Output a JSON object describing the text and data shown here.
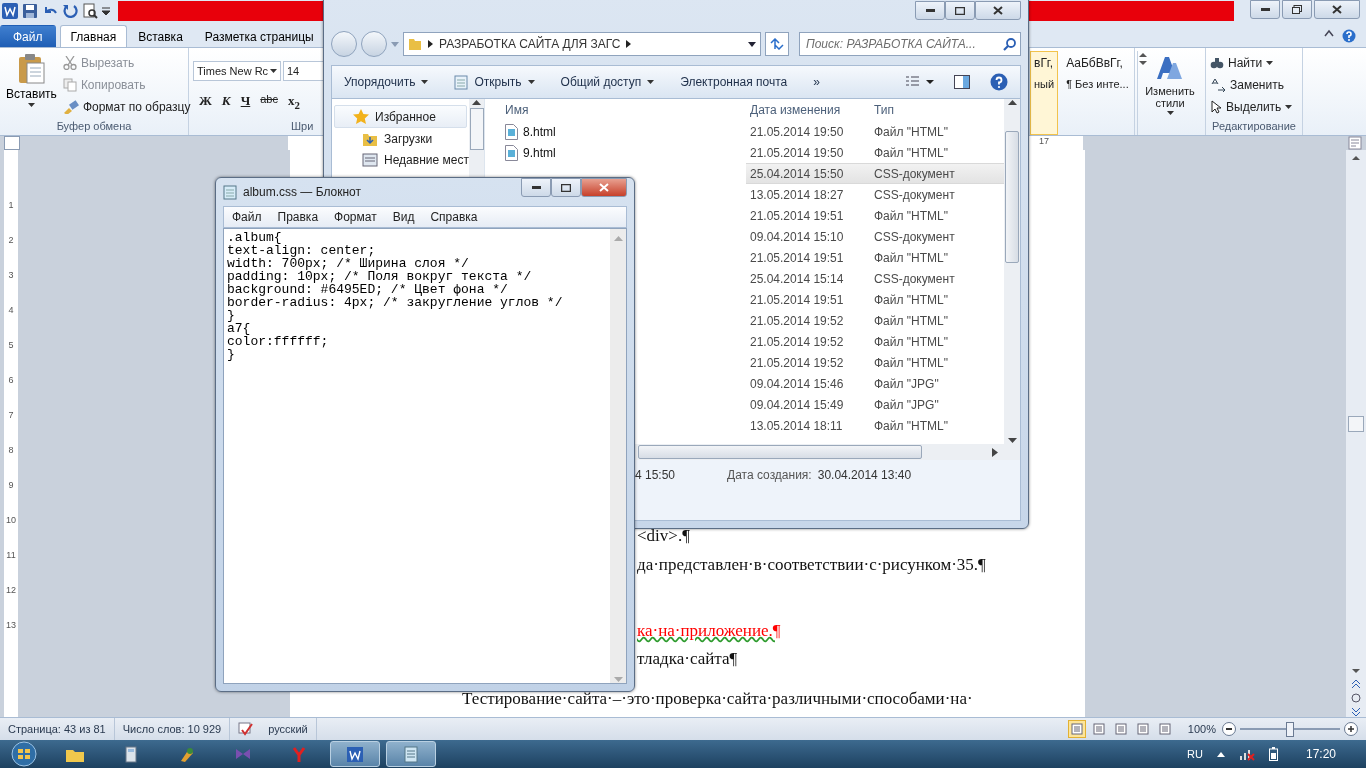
{
  "word": {
    "tabs": [
      {
        "label": "Файл",
        "kind": "file",
        "selected": false
      },
      {
        "label": "Главная",
        "kind": "tab",
        "selected": true
      },
      {
        "label": "Вставка",
        "kind": "tab",
        "selected": false
      },
      {
        "label": "Разметка страницы",
        "kind": "tab",
        "selected": false
      }
    ],
    "clipboard": {
      "paste": "Вставить",
      "cut": "Вырезать",
      "copy": "Копировать",
      "format_painter": "Формат по образцу",
      "group_label": "Буфер обмена"
    },
    "font": {
      "name": "Times New Rc",
      "size": "14",
      "format_buttons": [
        "Ж",
        "К",
        "Ч",
        "abc",
        "x$_{2}$"
      ],
      "group_label": "Шри"
    },
    "styles": [
      {
        "sample": "вГг,",
        "caption": "ный",
        "selected": true
      },
      {
        "sample": "АаБбВвГг,",
        "caption": "¶ Без инте...",
        "selected": false
      }
    ],
    "change_styles": "Изменить стили",
    "editing": {
      "find": "Найти",
      "replace": "Заменить",
      "select": "Выделить",
      "group_label": "Редактирование"
    },
    "ruler_label": "17",
    "vertical_ruler": [
      "1",
      "2",
      "3",
      "4",
      "5",
      "6",
      "7",
      "8",
      "9",
      "10",
      "11",
      "12",
      "13"
    ],
    "paragraphs": [
      {
        "text": "<div>.¶",
        "kind": "partial"
      },
      {
        "text": "да·представлен·в·соответствии·с·рисунком·35.¶",
        "kind": "partial"
      },
      {
        "text": "ка·на·приложение.¶",
        "kind": "gap",
        "color": "#ff0000"
      },
      {
        "text": "тладка·сайта¶",
        "kind": "partial"
      },
      {
        "text": "Тестирование·сайта·–·это·проверка·сайта·различными·способами·на·",
        "kind": "body"
      }
    ],
    "status_bar": {
      "page": "Страница: 43 из 81",
      "words": "Число слов: 10 929",
      "language": "русский",
      "views": [
        {
          "selected": true
        },
        {
          "selected": false
        },
        {
          "selected": false
        },
        {
          "selected": false
        },
        {
          "selected": false
        }
      ],
      "zoom": "100%",
      "zoom_slider": {
        "level": 0.5
      }
    }
  },
  "explorer": {
    "path": "РАЗРАБОТКА САЙТА ДЛЯ ЗАГС",
    "search": {
      "placeholder": "Поиск: РАЗРАБОТКА САЙТА..."
    },
    "toolbar": [
      {
        "label": "Упорядочить",
        "kind": "menu"
      },
      {
        "label": "Открыть",
        "kind": "open"
      },
      {
        "label": "Общий доступ",
        "kind": "menu"
      },
      {
        "label": "Электронная почта",
        "kind": "plain"
      },
      {
        "label": "»",
        "kind": "plain"
      }
    ],
    "nav": [
      {
        "label": "Избранное",
        "kind": "group"
      },
      {
        "label": "Загрузки",
        "kind": "downloads"
      },
      {
        "label": "Недавние мест",
        "kind": "recent"
      }
    ],
    "columns": [
      "Имя",
      "Дата изменения",
      "Тип"
    ],
    "rows": [
      {
        "name": "8.html",
        "date": "21.05.2014 19:50",
        "type": "Файл \"HTML\"",
        "selected": false
      },
      {
        "name": "9.html",
        "date": "21.05.2014 19:50",
        "type": "Файл \"HTML\"",
        "selected": false
      },
      {
        "date": "25.04.2014 15:50",
        "type": "CSS-документ",
        "selected": true
      },
      {
        "date": "13.05.2014 18:27",
        "type": "CSS-документ",
        "selected": false
      },
      {
        "date": "21.05.2014 19:51",
        "type": "Файл \"HTML\"",
        "selected": false
      },
      {
        "date": "09.04.2014 15:10",
        "type": "CSS-документ",
        "selected": false
      },
      {
        "date": "21.05.2014 19:51",
        "type": "Файл \"HTML\"",
        "selected": false
      },
      {
        "date": "25.04.2014 15:14",
        "type": "CSS-документ",
        "selected": false
      },
      {
        "date": "21.05.2014 19:51",
        "type": "Файл \"HTML\"",
        "selected": false
      },
      {
        "date": "21.05.2014 19:52",
        "type": "Файл \"HTML\"",
        "selected": false
      },
      {
        "date": "21.05.2014 19:52",
        "type": "Файл \"HTML\"",
        "selected": false
      },
      {
        "date": "21.05.2014 19:52",
        "type": "Файл \"HTML\"",
        "selected": false
      },
      {
        "date": "09.04.2014 15:46",
        "type": "Файл \"JPG\"",
        "selected": false
      },
      {
        "date": "09.04.2014 15:49",
        "type": "Файл \"JPG\"",
        "selected": false
      },
      {
        "date": "13.05.2014 18:11",
        "type": "Файл \"HTML\"",
        "selected": false
      }
    ],
    "details": {
      "modified": "4 15:50",
      "created_label": "Дата создания:",
      "created": "30.04.2014 13:40"
    }
  },
  "notepad": {
    "title": "album.css — Блокнот",
    "menu": [
      "Файл",
      "Правка",
      "Формат",
      "Вид",
      "Справка"
    ],
    "lines": [
      ".album{",
      "text-align: center;",
      "width: 700px; /* Ширина слоя */",
      "padding: 10px; /* Поля вокруг текста */",
      "background: #6495ED; /* Цвет фона */",
      "border-radius: 4px; /* закругление углов */",
      "}",
      "a7{",
      "color:ffffff;",
      "}"
    ]
  },
  "taskbar": {
    "language": "RU",
    "time": "17:20"
  }
}
